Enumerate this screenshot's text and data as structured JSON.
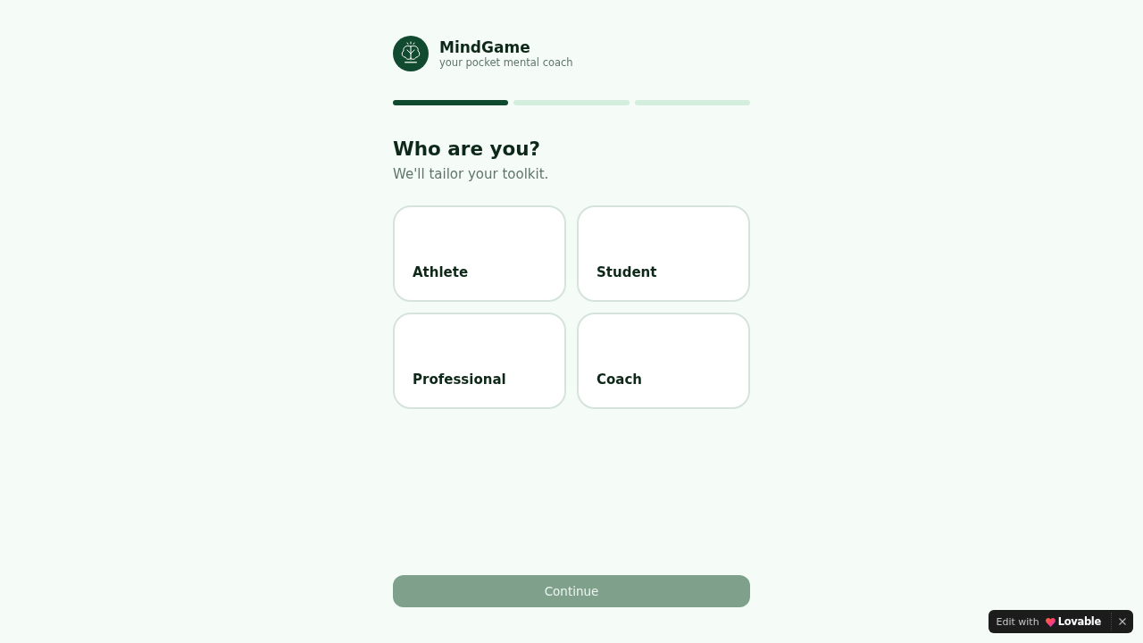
{
  "app": {
    "name": "MindGame",
    "tagline": "your pocket mental coach"
  },
  "progress": {
    "steps": [
      {
        "complete": true
      },
      {
        "complete": false
      },
      {
        "complete": false
      }
    ]
  },
  "question": {
    "title": "Who are you?",
    "subtitle": "We'll tailor your toolkit."
  },
  "options": [
    {
      "label": "Athlete",
      "selected": false
    },
    {
      "label": "Student",
      "selected": false
    },
    {
      "label": "Professional",
      "selected": false
    },
    {
      "label": "Coach",
      "selected": false
    }
  ],
  "continue_button": {
    "label": "Continue",
    "disabled": true
  },
  "badge": {
    "prefix": "Edit with",
    "brand": "Lovable"
  }
}
